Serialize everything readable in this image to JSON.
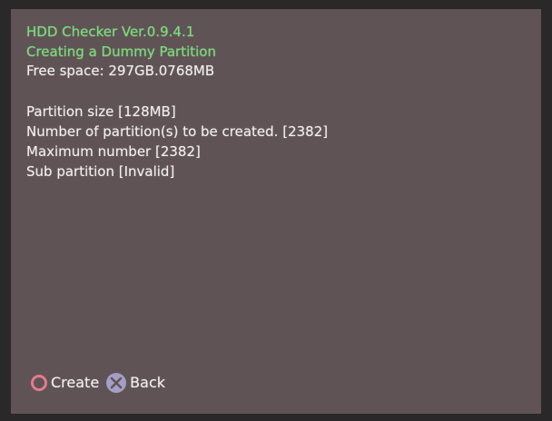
{
  "header": {
    "title": "HDD Checker Ver.0.9.4.1",
    "subtitle": "Creating a Dummy Partition",
    "free_space": "Free space: 297GB.0768MB"
  },
  "info": {
    "partition_size": "Partition size [128MB]",
    "partitions_to_create": "Number of partition(s) to be created. [2382]",
    "maximum_number": "Maximum number [2382]",
    "sub_partition": "Sub partition [Invalid]"
  },
  "footer": {
    "create_label": "Create",
    "back_label": "Back"
  },
  "icons": {
    "create": "circle-button-icon",
    "back": "cross-button-icon"
  },
  "colors": {
    "background": "#5f5356",
    "title_text": "#6fe36f",
    "body_text": "#f2eef0",
    "circle": "#e27b8a",
    "cross": "#a39fc6"
  }
}
